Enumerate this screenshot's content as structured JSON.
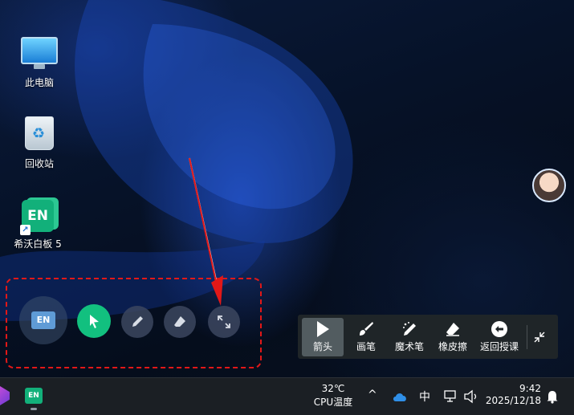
{
  "desktop": {
    "icons": [
      {
        "label": "此电脑",
        "icon": "computer-icon"
      },
      {
        "label": "回收站",
        "icon": "recycle-bin-icon"
      },
      {
        "label": "希沃白板 5",
        "icon": "seewo-whiteboard-icon",
        "glyph": "EN"
      }
    ]
  },
  "floating_tools": {
    "app_badge": "EN",
    "items": [
      "seewo-app-icon",
      "arrow-pointer-icon",
      "pen-icon",
      "eraser-icon",
      "expand-icon"
    ],
    "accent_color": "#12c07f"
  },
  "annotation": {
    "box_color": "#e21818",
    "arrow_color": "#e21818"
  },
  "toolbar": {
    "items": [
      {
        "label": "箭头",
        "icon": "arrow-pointer-icon",
        "active": true
      },
      {
        "label": "画笔",
        "icon": "brush-icon",
        "active": false
      },
      {
        "label": "魔术笔",
        "icon": "magic-pen-icon",
        "active": false
      },
      {
        "label": "橡皮擦",
        "icon": "eraser-icon",
        "active": false
      },
      {
        "label": "返回授课",
        "icon": "return-teaching-icon",
        "active": false
      }
    ],
    "collapse_icon": "collapse-icon"
  },
  "taskbar": {
    "pinned": [
      {
        "icon": "purple-app-icon"
      },
      {
        "icon": "seewo-taskbar-icon",
        "glyph": "EN"
      }
    ],
    "weather": {
      "temp": "32℃",
      "label": "CPU温度"
    },
    "tray": {
      "chevron": "^",
      "ime": "中",
      "time": "9:42",
      "date": "2025/12/18"
    }
  }
}
